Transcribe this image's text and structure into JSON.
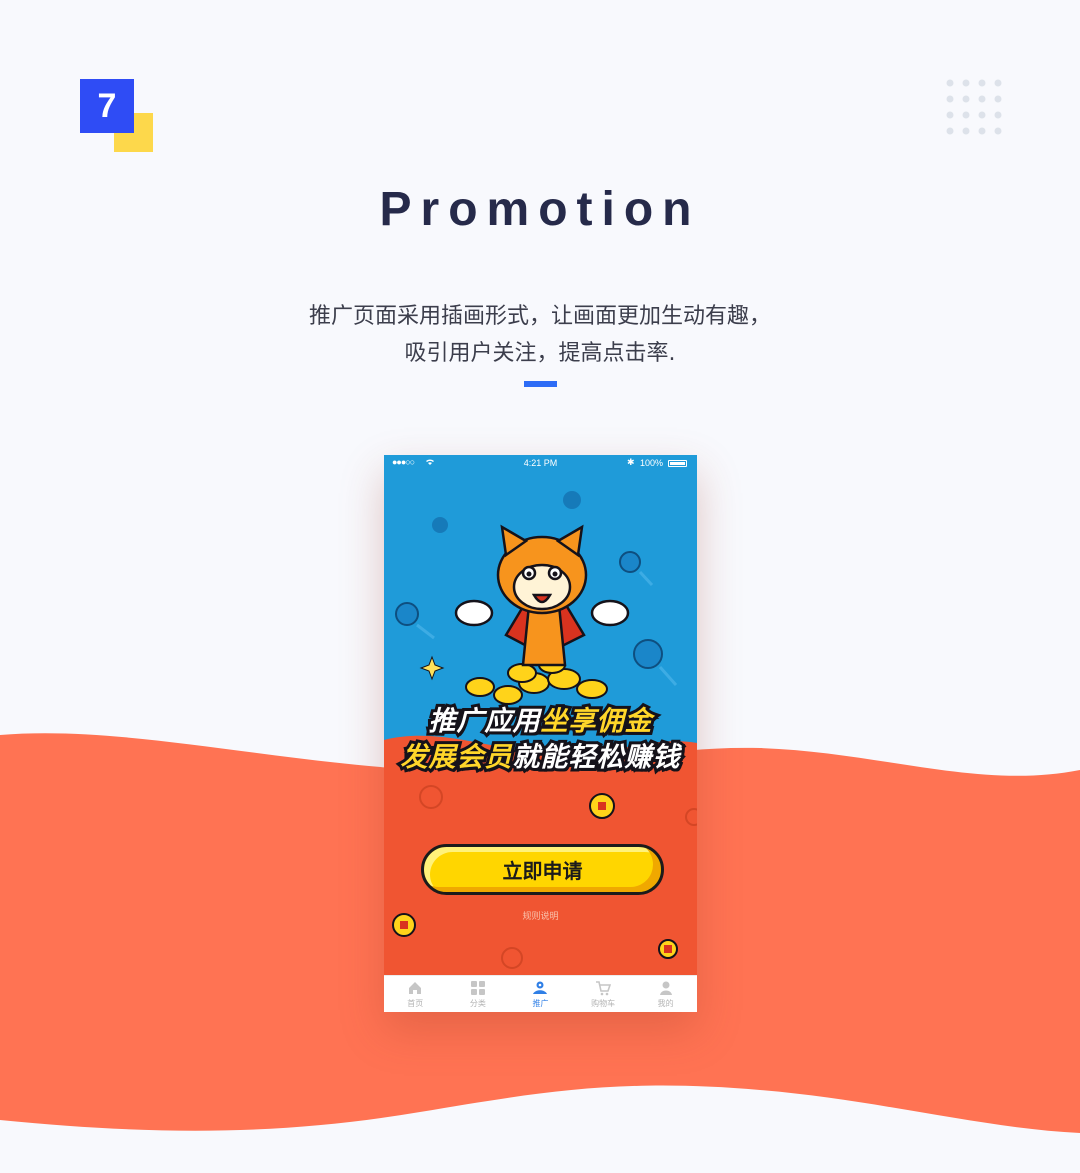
{
  "section": {
    "number": "7"
  },
  "title": "Promotion",
  "description": {
    "line1": "推广页面采用插画形式，让画面更加生动有趣，",
    "line2": "吸引用户关注，提高点击率."
  },
  "colors": {
    "badge_blue": "#2f4cf5",
    "badge_yellow": "#fdd84b",
    "accent": "#2d6cf6",
    "wave": "#ff7353",
    "phone_sky": "#1f9bd9",
    "phone_red": "#f05532",
    "button": "#ffd600"
  },
  "phone": {
    "statusbar": {
      "signal": "●●●○○",
      "time": "4:21 PM",
      "battery": "100%"
    },
    "headline": {
      "line1_white": "推广应用",
      "line1_gold": "坐享佣金",
      "line2_gold": "发展会员",
      "line2_white": "就能轻松赚钱"
    },
    "apply_button": "立即申请",
    "rules_link": "规则说明",
    "tabs": [
      {
        "label": "首页",
        "icon": "home-icon",
        "active": false
      },
      {
        "label": "分类",
        "icon": "grid-icon",
        "active": false
      },
      {
        "label": "推广",
        "icon": "promote-icon",
        "active": true
      },
      {
        "label": "购物车",
        "icon": "cart-icon",
        "active": false
      },
      {
        "label": "我的",
        "icon": "user-icon",
        "active": false
      }
    ]
  }
}
